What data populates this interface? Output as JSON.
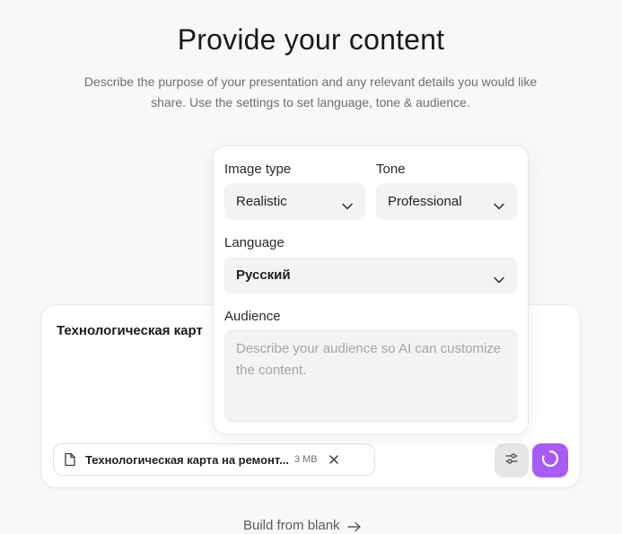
{
  "header": {
    "title": "Provide your content",
    "subtitle_line1": "Describe the purpose of your presentation and any relevant details you would like",
    "subtitle_line2": "share. Use the settings to set language, tone & audience."
  },
  "composer": {
    "text": "Технологическая карт",
    "attachment": {
      "name": "Технологическая карта на ремонт...",
      "size": "3 MB"
    },
    "icons": {
      "file": "file-icon",
      "remove": "close-icon",
      "settings": "sliders-icon",
      "submit": "loading-spinner-icon"
    }
  },
  "settings": {
    "image_type": {
      "label": "Image type",
      "value": "Realistic"
    },
    "tone": {
      "label": "Tone",
      "value": "Professional"
    },
    "language": {
      "label": "Language",
      "value": "Русский"
    },
    "audience": {
      "label": "Audience",
      "placeholder": "Describe your audience so AI can customize the content."
    }
  },
  "footer": {
    "build_from_blank": "Build from blank"
  },
  "colors": {
    "accent": "#a65cf5",
    "background": "#f8f8f8",
    "field_bg": "#f3f3f3"
  }
}
